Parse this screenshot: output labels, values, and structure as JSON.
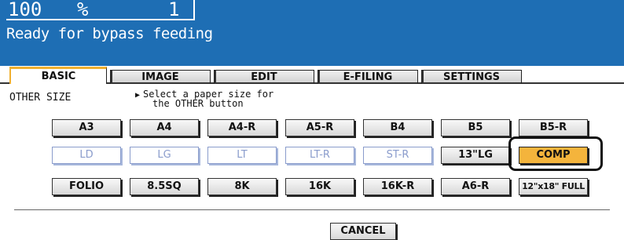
{
  "header": {
    "zoom_value": "100",
    "zoom_unit": "%",
    "copies": "1",
    "status": "Ready for bypass feeding"
  },
  "tabs": [
    {
      "label": "BASIC",
      "active": true
    },
    {
      "label": "IMAGE",
      "active": false
    },
    {
      "label": "EDIT",
      "active": false
    },
    {
      "label": "E-FILING",
      "active": false
    },
    {
      "label": "SETTINGS",
      "active": false
    }
  ],
  "section": {
    "title": "OTHER SIZE",
    "hint_line1": "Select a paper size for",
    "hint_line2": "the OTHER button"
  },
  "paper_sizes": {
    "row1": [
      "A3",
      "A4",
      "A4-R",
      "A5-R",
      "B4",
      "B5",
      "B5-R"
    ],
    "row2": [
      "LD",
      "LG",
      "LT",
      "LT-R",
      "ST-R",
      "13\"LG",
      "COMP"
    ],
    "row3": [
      "FOLIO",
      "8.5SQ",
      "8K",
      "16K",
      "16K-R",
      "A6-R",
      "12\"x18\" FULL"
    ],
    "disabled": [
      "LD",
      "LG",
      "LT",
      "LT-R",
      "ST-R"
    ],
    "selected": "COMP"
  },
  "footer": {
    "cancel_label": "CANCEL"
  },
  "colors": {
    "header_bg": "#1e6eb4",
    "selected_bg": "#f4b43c",
    "active_tab_accent": "#f0b030",
    "disabled_text": "#8a9ccc"
  }
}
